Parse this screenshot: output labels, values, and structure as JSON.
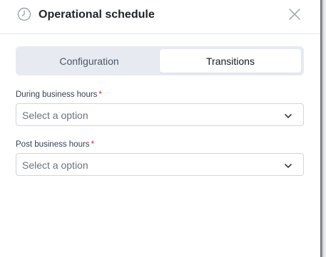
{
  "header": {
    "title": "Operational schedule",
    "icon": "clock-icon",
    "close_icon": "close-icon"
  },
  "tabs": [
    {
      "label": "Configuration",
      "active": false
    },
    {
      "label": "Transitions",
      "active": true
    }
  ],
  "fields": [
    {
      "label": "During business hours",
      "required_marker": "*",
      "placeholder": "Select a option",
      "icon": "chevron-down-icon"
    },
    {
      "label": "Post business hours",
      "required_marker": "*",
      "placeholder": "Select a option",
      "icon": "chevron-down-icon"
    }
  ],
  "colors": {
    "required": "#dc2626",
    "tab_bg": "#e7ebf1",
    "active_tab": "#ffffff"
  }
}
